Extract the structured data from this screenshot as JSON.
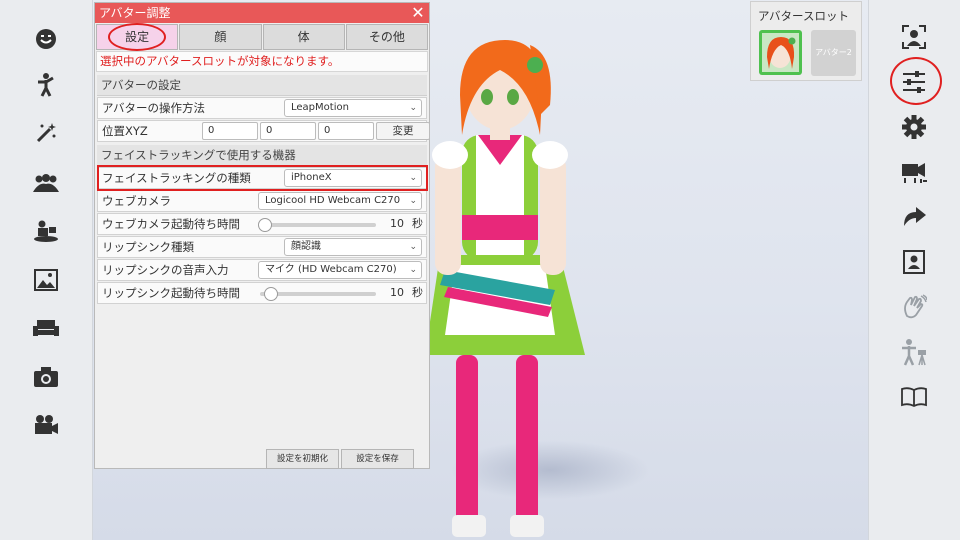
{
  "panel": {
    "title": "アバター調整",
    "tabs": [
      "設定",
      "顔",
      "体",
      "その他"
    ],
    "notice": "選択中のアバタースロットが対象になります。",
    "section_avatar": "アバターの設定",
    "operation_label": "アバターの操作方法",
    "operation_value": "LeapMotion",
    "position_label": "位置XYZ",
    "position_x": "0",
    "position_y": "0",
    "position_z": "0",
    "position_change_label": "変更",
    "section_face": "フェイストラッキングで使用する機器",
    "face_type_label": "フェイストラッキングの種類",
    "face_type_value": "iPhoneX",
    "webcam_label": "ウェブカメラ",
    "webcam_value": "Logicool HD Webcam C270",
    "webcam_wait_label": "ウェブカメラ起動待ち時間",
    "webcam_wait_value": "10",
    "webcam_wait_unit": "秒",
    "lipsync_type_label": "リップシンク種類",
    "lipsync_type_value": "顔認識",
    "lipsync_audio_label": "リップシンクの音声入力",
    "lipsync_audio_value": "マイク (HD Webcam C270)",
    "lipsync_wait_label": "リップシンク起動待ち時間",
    "lipsync_wait_value": "10",
    "lipsync_wait_unit": "秒",
    "reset_label": "設定を初期化",
    "save_label": "設定を保存"
  },
  "slots": {
    "title": "アバタースロット",
    "slot2_label": "アバター2"
  },
  "left_icons": [
    "face-icon",
    "pose-icon",
    "magic-wand-icon",
    "group-icon",
    "stage-camera-icon",
    "image-icon",
    "sofa-icon",
    "camera-icon",
    "movie-camera-icon"
  ],
  "right_icons": [
    "avatar-adjust-icon",
    "sliders-icon",
    "gear-icon",
    "video-camera-icon",
    "redo-icon",
    "portrait-icon",
    "hand-wave-icon",
    "tripod-person-icon",
    "book-icon"
  ],
  "colors": {
    "title_bar": "#e85858",
    "highlight": "#e02020",
    "active_tab": "#f6d2ea",
    "slot_green": "#4fc14f"
  }
}
